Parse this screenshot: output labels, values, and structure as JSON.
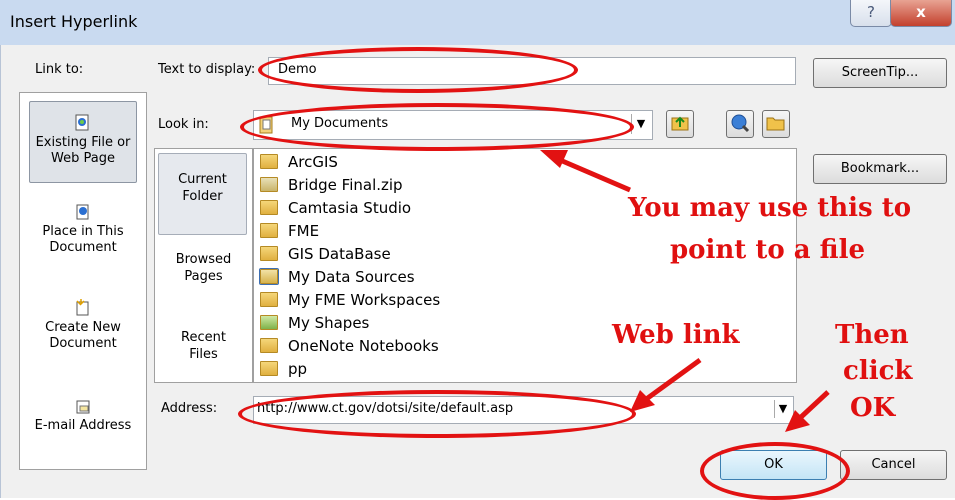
{
  "window": {
    "title": "Insert Hyperlink",
    "help_glyph": "?",
    "close_glyph": "x"
  },
  "labels": {
    "link_to": "Link to:",
    "text_to_display": "Text to display:",
    "look_in": "Look in:",
    "address": "Address:"
  },
  "inputs": {
    "text_to_display": "Demo",
    "look_in": "My Documents",
    "address": "http://www.ct.gov/dotsi/site/default.asp"
  },
  "link_to_items": [
    {
      "label1": "Existing File or",
      "label2": "Web Page",
      "icon": "existing-file-icon",
      "selected": true
    },
    {
      "label1": "Place in This",
      "label2": "Document",
      "icon": "place-in-document-icon"
    },
    {
      "label1": "Create New",
      "label2": "Document",
      "icon": "new-document-icon"
    },
    {
      "label1": "E-mail Address",
      "label2": "",
      "icon": "email-address-icon"
    }
  ],
  "browse_items": [
    {
      "label1": "Current",
      "label2": "Folder",
      "selected": true
    },
    {
      "label1": "Browsed",
      "label2": "Pages"
    },
    {
      "label1": "Recent",
      "label2": "Files"
    }
  ],
  "files": [
    "ArcGIS",
    "Bridge Final.zip",
    "Camtasia Studio",
    "FME",
    "GIS DataBase",
    "My Data Sources",
    "My FME Workspaces",
    "My Shapes",
    "OneNote Notebooks",
    "pp"
  ],
  "buttons": {
    "screentip": "ScreenTip...",
    "bookmark": "Bookmark...",
    "ok": "OK",
    "cancel": "Cancel"
  },
  "annotations": {
    "point_file_1": "You may use this to",
    "point_file_2": "point to  a file",
    "web_link": "Web link",
    "then_1": "Then",
    "then_2": "click",
    "then_3": "OK"
  },
  "colors": {
    "annotation": "#e01010",
    "title_bar": "#c9daf0",
    "dialog_bg": "#f0f0f0"
  }
}
